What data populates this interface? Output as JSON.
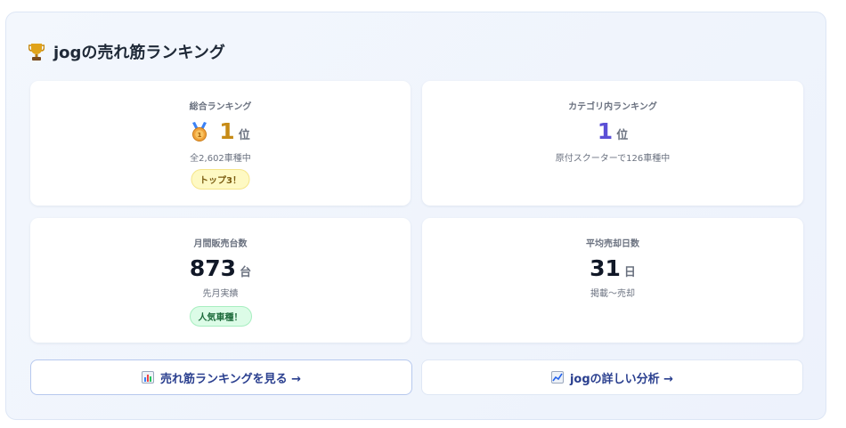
{
  "header": {
    "title": "jogの売れ筋ランキング"
  },
  "colors": {
    "gold": "#c78b16",
    "purple": "#5b4fd6",
    "dark": "#111827"
  },
  "cards": {
    "overall": {
      "label": "総合ランキング",
      "value": "1",
      "unit": "位",
      "sub": "全2,602車種中",
      "badge": "トップ3！",
      "icon": "medal-icon"
    },
    "category": {
      "label": "カテゴリ内ランキング",
      "value": "1",
      "unit": "位",
      "sub": "原付スクーターで126車種中"
    },
    "monthly": {
      "label": "月間販売台数",
      "value": "873",
      "unit": "台",
      "sub": "先月実績",
      "badge": "人気車種！"
    },
    "days": {
      "label": "平均売却日数",
      "value": "31",
      "unit": "日",
      "sub": "掲載〜売却"
    }
  },
  "buttons": {
    "ranking": {
      "label": "売れ筋ランキングを見る →",
      "icon": "bar-chart-icon"
    },
    "analysis": {
      "label": "jogの詳しい分析 →",
      "icon": "line-chart-icon"
    }
  }
}
